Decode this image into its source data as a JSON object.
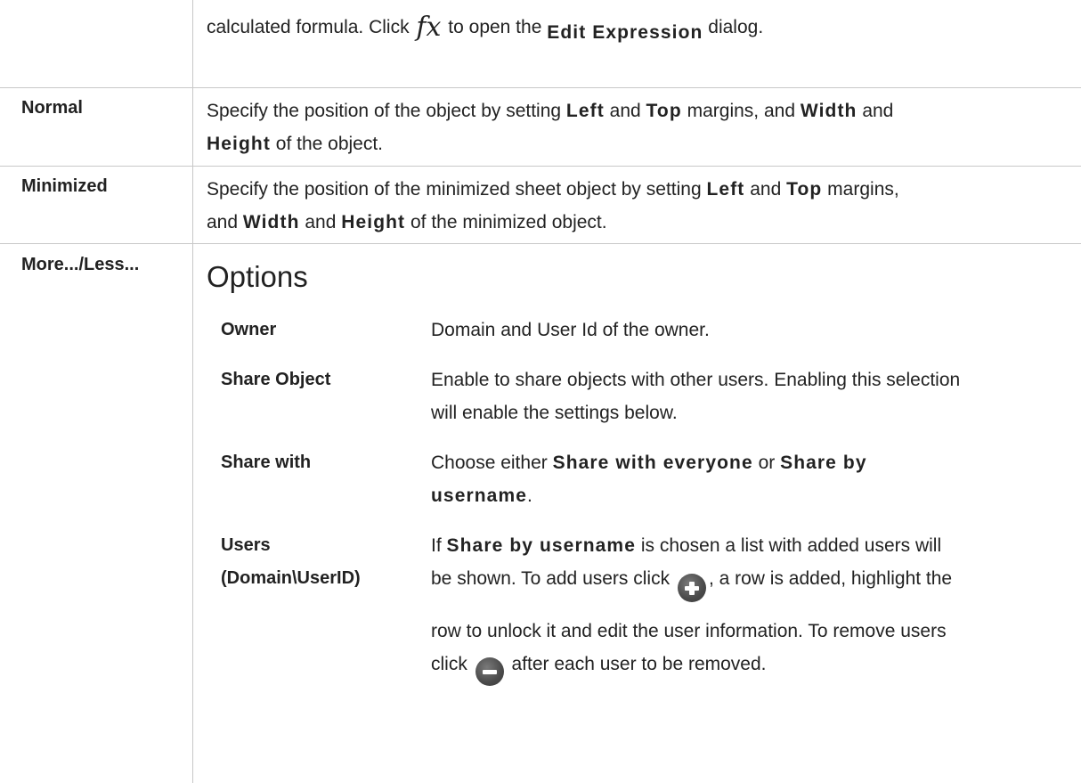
{
  "rows": {
    "top": {
      "text_a": "calculated formula. Click ",
      "text_b": " to open the ",
      "bold": "Edit Expression",
      "text_c": " dialog."
    },
    "normal": {
      "label": "Normal",
      "l1_a": "Specify the position of the object by setting ",
      "l1_b1": "Left",
      "l1_c": " and ",
      "l1_b2": "Top",
      "l1_d": " margins, and ",
      "l1_b3": "Width",
      "l1_e": " and",
      "l2_b1": "Height",
      "l2_a": " of the object."
    },
    "minimized": {
      "label": "Minimized",
      "l1_a": "Specify the position of the minimized sheet object by setting ",
      "l1_b1": "Left",
      "l1_c": " and ",
      "l1_b2": "Top",
      "l1_d": " margins,",
      "l2_a": "and ",
      "l2_b1": "Width",
      "l2_c": " and ",
      "l2_b2": "Height",
      "l2_d": " of the minimized object."
    },
    "more_less": {
      "label": "More.../Less...",
      "options_title": "Options",
      "owner": {
        "label": "Owner",
        "desc": "Domain and User Id of the owner."
      },
      "share_object": {
        "label": "Share Object",
        "l1": "Enable to share objects with other users. Enabling this selection",
        "l2": "will enable the settings below."
      },
      "share_with": {
        "label": "Share with",
        "l1_a": "Choose either ",
        "l1_b1": "Share with everyone",
        "l1_c": " or ",
        "l1_b2": "Share by",
        "l2_b": "username",
        "l2_a": "."
      },
      "users": {
        "label_1": "Users",
        "label_2": "(Domain\\UserID)",
        "l1_a": "If ",
        "l1_b": "Share by username",
        "l1_c": " is chosen a list with added users will",
        "l2_a": "be shown. To add users click ",
        "l2_b": ", a row is added, highlight the",
        "l3": "row to unlock it and edit the user information. To remove users",
        "l4_a": "click ",
        "l4_b": " after each user to be removed."
      }
    }
  }
}
